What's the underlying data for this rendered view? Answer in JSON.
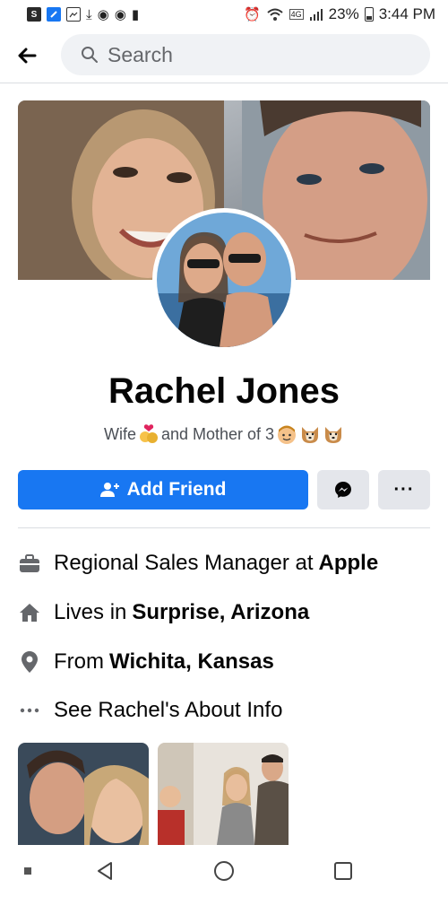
{
  "status_bar": {
    "left_icons": [
      "s-app-icon",
      "facebook-icon",
      "image-icon",
      "download-icon",
      "eye-icon",
      "eye-icon",
      "lock-icon"
    ],
    "battery_percent": "23%",
    "time": "3:44 PM",
    "network": "4G"
  },
  "header": {
    "search_placeholder": "Search"
  },
  "profile": {
    "name": "Rachel Jones",
    "bio_part1": "Wife",
    "bio_part2": "and Mother of 3"
  },
  "actions": {
    "add_friend_label": "Add Friend",
    "more_label": "···"
  },
  "intro": {
    "work_prefix": "Regional Sales Manager at",
    "work_company": "Apple",
    "lives_prefix": "Lives in",
    "lives_place": "Surprise, Arizona",
    "from_prefix": "From",
    "from_place": "Wichita, Kansas",
    "about_link": "See Rachel's About Info"
  },
  "colors": {
    "accent": "#1877f2",
    "secondary_button": "#e4e6eb",
    "icon_gray": "#65676b"
  }
}
